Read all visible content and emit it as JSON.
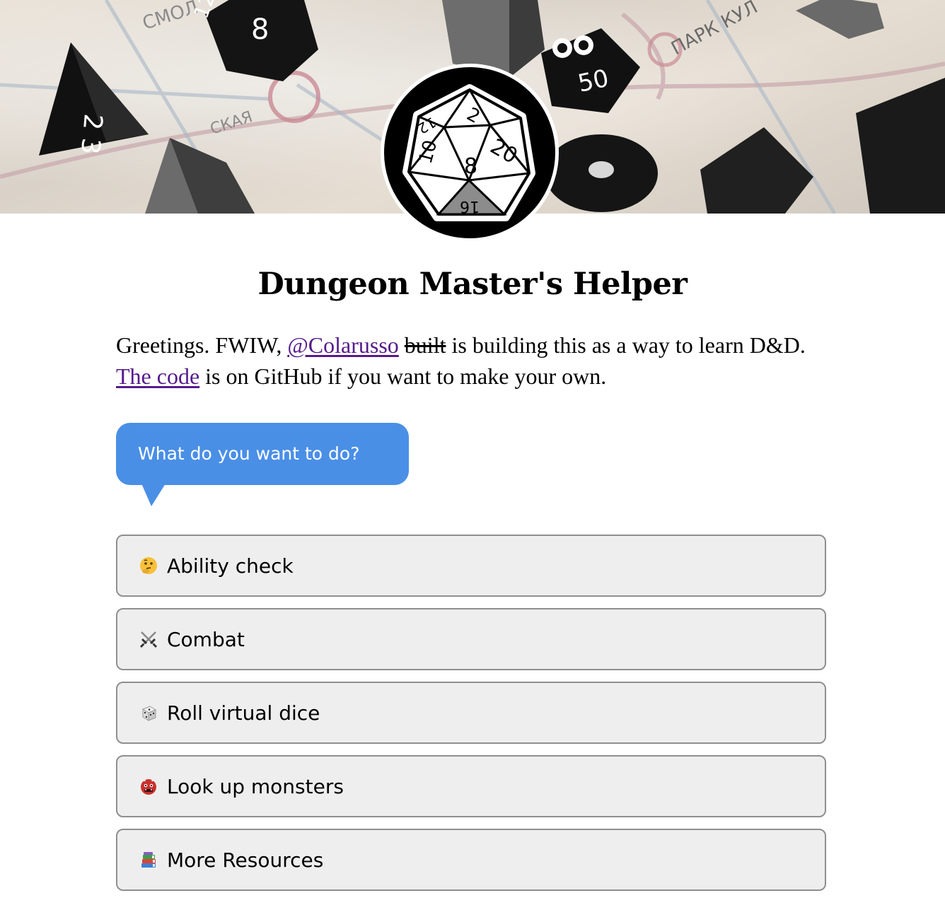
{
  "header": {
    "hero_image": "dice-on-map-banner",
    "logo": "d20-icon"
  },
  "page": {
    "title": "Dungeon Master's Helper"
  },
  "intro": {
    "greeting": "Greetings. FWIW,",
    "author_link": "@Colarusso",
    "struck_word": "built",
    "middle": "is building this as a way to learn D&D.",
    "code_link": "The code",
    "end": "is on GitHub if you want to make your own."
  },
  "prompt": {
    "text": "What do you want to do?",
    "bubble_color": "#4a8fe6"
  },
  "options": [
    {
      "icon": "thinking-face-icon",
      "label": "Ability check"
    },
    {
      "icon": "crossed-swords-icon",
      "label": "Combat"
    },
    {
      "icon": "dice-icon",
      "label": "Roll virtual dice"
    },
    {
      "icon": "ogre-icon",
      "label": "Look up monsters"
    },
    {
      "icon": "books-icon",
      "label": "More Resources"
    }
  ],
  "colors": {
    "link": "#551a8b",
    "button_bg": "#eeeeee",
    "button_border": "#8f8f8f"
  }
}
